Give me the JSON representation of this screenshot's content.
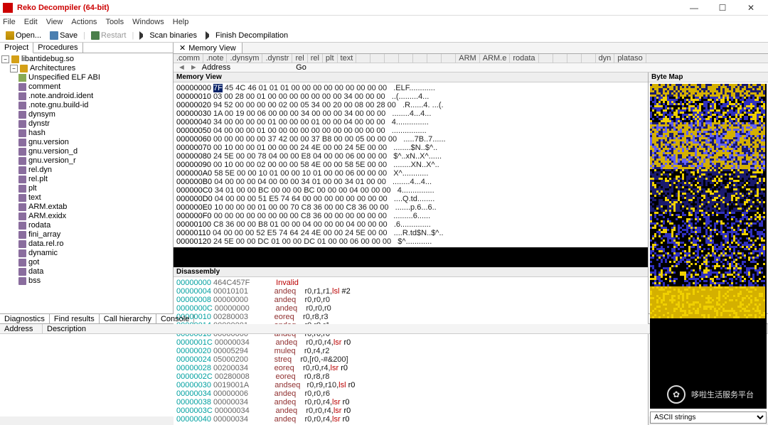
{
  "title": "Reko Decompiler (64-bit)",
  "winbtns": {
    "min": "—",
    "max": "☐",
    "close": "✕"
  },
  "menu": [
    "File",
    "Edit",
    "View",
    "Actions",
    "Tools",
    "Windows",
    "Help"
  ],
  "toolbar": {
    "open": "Open...",
    "save": "Save",
    "restart": "Restart",
    "scan": "Scan binaries",
    "finish": "Finish Decompilation"
  },
  "lefttabs": {
    "project": "Project",
    "procedures": "Procedures"
  },
  "tree": {
    "root": "libantidebug.so",
    "arch": "Architectures",
    "archchild": "Unspecified ELF ABI",
    "segments": [
      "comment",
      ".note.android.ident",
      ".note.gnu.build-id",
      "dynsym",
      "dynstr",
      "hash",
      "gnu.version",
      "gnu.version_d",
      "gnu.version_r",
      "rel.dyn",
      "rel.plt",
      "plt",
      "text",
      "ARM.extab",
      "ARM.exidx",
      "rodata",
      "fini_array",
      "data.rel.ro",
      "dynamic",
      "got",
      "data",
      "bss"
    ]
  },
  "doctab": {
    "close": "✕",
    "label": "Memory View"
  },
  "segtabs": [
    ".comm",
    ".note",
    ".dynsym",
    ".dynstr",
    "rel",
    "rel",
    "plt",
    "text",
    "",
    "",
    "",
    "",
    "",
    "",
    "",
    "ARM",
    "ARM.e",
    "rodata",
    "",
    "",
    "",
    "",
    "dyn",
    "plataso"
  ],
  "addrbar": {
    "label": "Address",
    "go": "Go"
  },
  "panes": {
    "memory": "Memory View",
    "disasm": "Disassembly",
    "byte": "Byte Map"
  },
  "hex": [
    {
      "a": "00000000",
      "b": "7F 45 4C 46 01 01 01 00 00 00 00 00 00 00 00 00",
      "c": ".ELF............",
      "hl": true
    },
    {
      "a": "00000010",
      "b": "03 00 28 00 01 00 00 00 00 00 00 00 34 00 00 00",
      "c": "..(.........4..."
    },
    {
      "a": "00000020",
      "b": "94 52 00 00 00 00 02 00 05 34 00 20 00 08 00 28 00",
      "c": ".R......4. ...(."
    },
    {
      "a": "00000030",
      "b": "1A 00 19 00 06 00 00 00 34 00 00 00 34 00 00 00",
      "c": "........4...4..."
    },
    {
      "a": "00000040",
      "b": "34 00 00 00 00 01 00 00 00 01 00 00 04 00 00 00",
      "c": "4..............."
    },
    {
      "a": "00000050",
      "b": "04 00 00 00 01 00 00 00 00 00 00 00 00 00 00 00",
      "c": "................"
    },
    {
      "a": "00000060",
      "b": "00 00 00 00 00 37 42 00 00 37 B8 00 00 05 00 00 00",
      "c": ".....7B..7......"
    },
    {
      "a": "00000070",
      "b": "00 10 00 00 01 00 00 00 24 4E 00 00 24 5E 00 00",
      "c": "........$N..$^.."
    },
    {
      "a": "00000080",
      "b": "24 5E 00 00 78 04 00 00 E8 04 00 00 06 00 00 00",
      "c": "$^..xN..X^......"
    },
    {
      "a": "00000090",
      "b": "00 10 00 00 02 00 00 00 58 4E 00 00 58 5E 00 00",
      "c": "........XN..X^.."
    },
    {
      "a": "000000A0",
      "b": "58 5E 00 00 10 01 00 00 10 01 00 00 06 00 00 00",
      "c": "X^............"
    },
    {
      "a": "000000B0",
      "b": "04 00 00 00 04 00 00 00 34 01 00 00 34 01 00 00",
      "c": "........4...4..."
    },
    {
      "a": "000000C0",
      "b": "34 01 00 00 BC 00 00 00 BC 00 00 00 04 00 00 00",
      "c": "4..............."
    },
    {
      "a": "000000D0",
      "b": "04 00 00 00 51 E5 74 64 00 00 00 00 00 00 00 00",
      "c": "....Q.td........"
    },
    {
      "a": "000000E0",
      "b": "10 00 00 00 01 00 00 70 C8 36 00 00 C8 36 00 00",
      "c": ".......p.6...6.."
    },
    {
      "a": "000000F0",
      "b": "00 00 00 00 00 00 00 00 C8 36 00 00 00 00 00 00",
      "c": ".........6......"
    },
    {
      "a": "00000100",
      "b": "C8 36 00 00 B8 01 00 00 04 00 00 00 04 00 00 00",
      "c": ".6.............."
    },
    {
      "a": "00000110",
      "b": "04 00 00 00 52 E5 74 64 24 4E 00 00 24 5E 00 00",
      "c": "....R.td$N..$^.."
    },
    {
      "a": "00000120",
      "b": "24 5E 00 00 DC 01 00 00 DC 01 00 00 06 00 00 00",
      "c": "$^............"
    }
  ],
  "disasm": [
    {
      "a": "00000000",
      "h": "464C457F",
      "m": "Invalid",
      "o": ""
    },
    {
      "a": "00000004",
      "h": "00010101",
      "m": "andeq",
      "o": "r0,r1,r1,",
      "x": "lsl",
      "n": " #2"
    },
    {
      "a": "00000008",
      "h": "00000000",
      "m": "andeq",
      "o": "r0,r0,r0"
    },
    {
      "a": "0000000C",
      "h": "00000000",
      "m": "andeq",
      "o": "r0,r0,r0"
    },
    {
      "a": "00000010",
      "h": "00280003",
      "m": "eoreq",
      "o": "r0,r8,r3"
    },
    {
      "a": "00000014",
      "h": "00000001",
      "m": "andeq",
      "o": "r0,r0,r1"
    },
    {
      "a": "00000018",
      "h": "00000000",
      "m": "andeq",
      "o": "r0,r0,r0"
    },
    {
      "a": "0000001C",
      "h": "00000034",
      "m": "andeq",
      "o": "r0,r0,r4,",
      "x": "lsr",
      "n": " r0"
    },
    {
      "a": "00000020",
      "h": "00005294",
      "m": "muleq",
      "o": "r0,r4,r2"
    },
    {
      "a": "00000024",
      "h": "05000200",
      "m": "streq",
      "o": "r0,[r0,-#&200]"
    },
    {
      "a": "00000028",
      "h": "00200034",
      "m": "eoreq",
      "o": "r0,r0,r4,",
      "x": "lsr",
      "n": " r0"
    },
    {
      "a": "0000002C",
      "h": "00280008",
      "m": "eoreq",
      "o": "r0,r8,r8"
    },
    {
      "a": "00000030",
      "h": "0019001A",
      "m": "andseq",
      "o": "r0,r9,r10,",
      "x": "lsl",
      "n": " r0"
    },
    {
      "a": "00000034",
      "h": "00000006",
      "m": "andeq",
      "o": "r0,r0,r6"
    },
    {
      "a": "00000038",
      "h": "00000034",
      "m": "andeq",
      "o": "r0,r0,r4,",
      "x": "lsr",
      "n": " r0"
    },
    {
      "a": "0000003C",
      "h": "00000034",
      "m": "andeq",
      "o": "r0,r0,r4,",
      "x": "lsr",
      "n": " r0"
    },
    {
      "a": "00000040",
      "h": "00000034",
      "m": "andeq",
      "o": "r0,r0,r4,",
      "x": "lsr",
      "n": " r0"
    }
  ],
  "bytedrop": "ASCII strings",
  "bottomtabs": [
    "Diagnostics",
    "Find results",
    "Call hierarchy",
    "Console"
  ],
  "bcols": {
    "addr": "Address",
    "desc": "Description"
  },
  "watermark": "哆啦生活服务平台"
}
